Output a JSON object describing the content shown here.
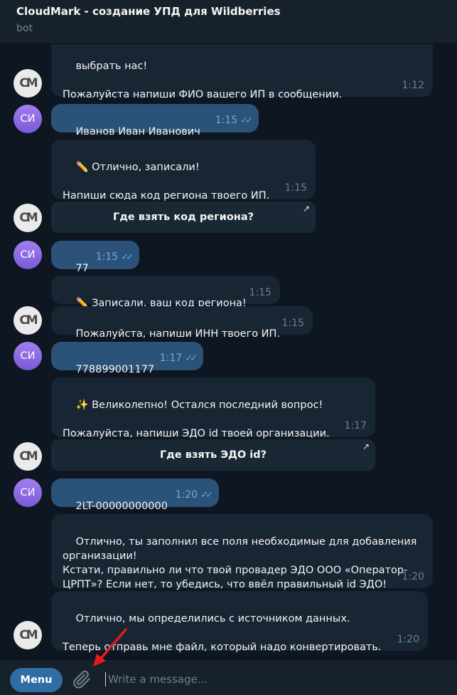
{
  "header": {
    "title": "CloudMark - создание УПД для Wildberries",
    "subtitle": "bot"
  },
  "avatars": {
    "bot_initials": "СМ",
    "user_initials": "СИ"
  },
  "messages": [
    {
      "from": "bot",
      "text": "выбрать нас!\n\nПожалуйста напиши ФИО вашего ИП в сообщении.",
      "time": "1:12"
    },
    {
      "from": "user",
      "text": "Иванов Иван Иванович",
      "time": "1:15"
    },
    {
      "from": "bot",
      "text": "✏️ Отлично, записали!\n\nНапиши сюда код региона твоего ИП.",
      "time": "1:15",
      "button": "Где взять код региона?"
    },
    {
      "from": "user",
      "text": "77",
      "time": "1:15"
    },
    {
      "from": "bot",
      "text": "✏️ Записали, ваш код региона!",
      "time": "1:15"
    },
    {
      "from": "bot",
      "text": "Пожалуйста, напиши ИНН твоего ИП.",
      "time": "1:15"
    },
    {
      "from": "user",
      "text": "778899001177",
      "time": "1:17"
    },
    {
      "from": "bot",
      "text": "✨ Великолепно! Остался последний вопрос!\n\nПожалуйста, напиши ЭДО id твоей организации.",
      "time": "1:17",
      "button": "Где взять ЭДО id?"
    },
    {
      "from": "user",
      "text": "2LT-00000000000",
      "time": "1:20"
    },
    {
      "from": "bot",
      "text": "Отлично, ты заполнил все поля необходимые для добавления организации!\nКстати, правильно ли что твой провадер ЭДО ООО «Оператор-ЦРПТ»? Если нет, то убедись, что ввёл правильный id ЭДО!",
      "time": "1:20"
    },
    {
      "from": "bot",
      "text": "Отлично, мы определились с источником данных.\n\nТеперь отправь мне файл, который надо конвертировать.",
      "time": "1:20"
    }
  ],
  "footer": {
    "menu_label": "Menu",
    "input_placeholder": "Write a message..."
  },
  "colors": {
    "background": "#0e1621",
    "incoming": "#182533",
    "outgoing": "#2b5278",
    "accent": "#2f6ea5",
    "annotation": "#e31b1b"
  }
}
